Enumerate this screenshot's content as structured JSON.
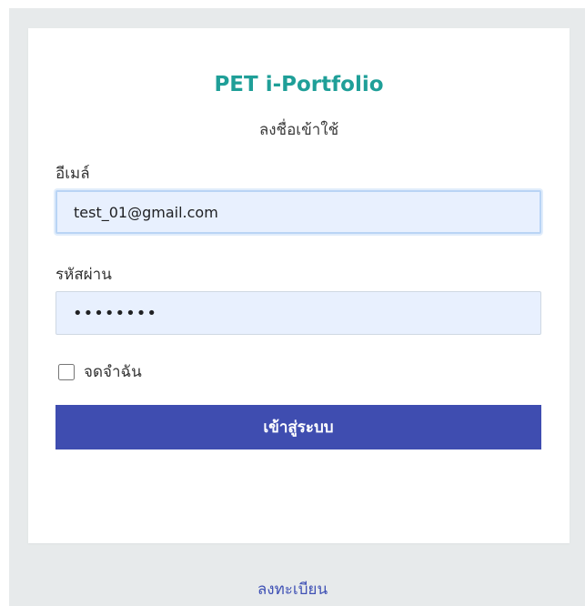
{
  "login": {
    "title": "PET i-Portfolio",
    "subtitle": "ลงชื่อเข้าใช้",
    "email_label": "อีเมล์",
    "email_value": "test_01@gmail.com",
    "password_label": "รหัสผ่าน",
    "password_value": "••••••••",
    "remember_label": "จดจำฉัน",
    "login_button": "เข้าสู่ระบบ"
  },
  "footer": {
    "register_link": "ลงทะเบียน"
  },
  "colors": {
    "title": "#1f9f98",
    "button": "#3f4db0",
    "input_bg": "#e8f0fe",
    "page_bg": "#e7eaeb"
  }
}
